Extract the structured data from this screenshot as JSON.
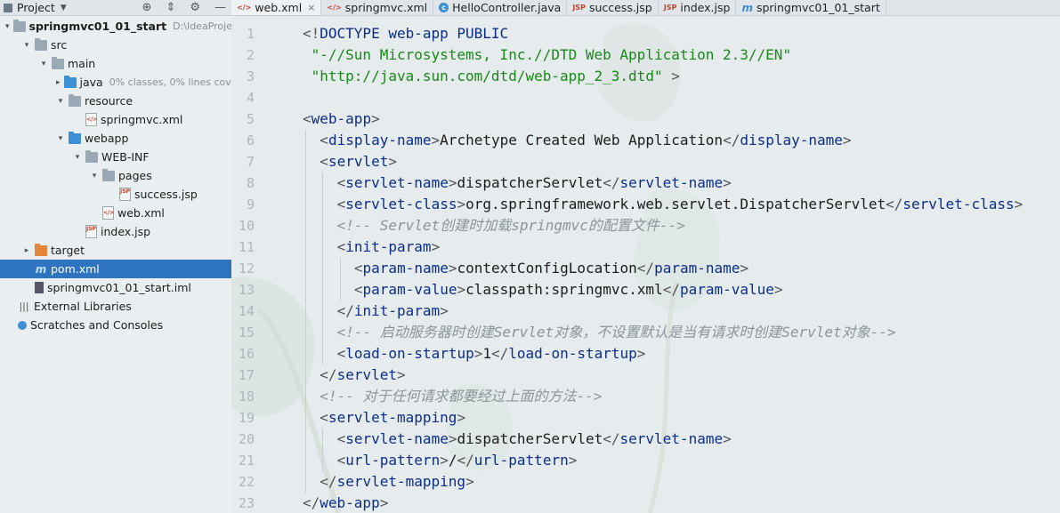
{
  "project_panel": {
    "title": "Project",
    "tree": [
      {
        "label": "springmvc01_01_start",
        "extra": "D:\\IdeaProjects\\",
        "indent": 0,
        "arrow": "open",
        "icon": "folder",
        "bold": true
      },
      {
        "label": "src",
        "indent": 1,
        "arrow": "open",
        "icon": "folder"
      },
      {
        "label": "main",
        "indent": 2,
        "arrow": "open",
        "icon": "folder"
      },
      {
        "label": "java",
        "extra": "0% classes, 0% lines cove",
        "indent": 3,
        "arrow": "closed",
        "icon": "folder-blue"
      },
      {
        "label": "resource",
        "indent": 3,
        "arrow": "open",
        "icon": "folder"
      },
      {
        "label": "springmvc.xml",
        "indent": 4,
        "arrow": "none",
        "icon": "xml"
      },
      {
        "label": "webapp",
        "indent": 3,
        "arrow": "open",
        "icon": "folder-blue"
      },
      {
        "label": "WEB-INF",
        "indent": 4,
        "arrow": "open",
        "icon": "folder"
      },
      {
        "label": "pages",
        "indent": 5,
        "arrow": "open",
        "icon": "folder"
      },
      {
        "label": "success.jsp",
        "indent": 6,
        "arrow": "none",
        "icon": "jsp"
      },
      {
        "label": "web.xml",
        "indent": 5,
        "arrow": "none",
        "icon": "xml"
      },
      {
        "label": "index.jsp",
        "indent": 4,
        "arrow": "none",
        "icon": "jsp"
      },
      {
        "label": "target",
        "indent": 1,
        "arrow": "closed",
        "icon": "folder-orange"
      },
      {
        "label": "pom.xml",
        "indent": 1,
        "arrow": "none",
        "icon": "maven",
        "selected": true
      },
      {
        "label": "springmvc01_01_start.iml",
        "indent": 1,
        "arrow": "none",
        "icon": "iml"
      },
      {
        "label": "External Libraries",
        "indent": 0,
        "arrow": "none",
        "icon": "library"
      },
      {
        "label": "Scratches and Consoles",
        "indent": 0,
        "arrow": "none",
        "icon": "scratches"
      }
    ]
  },
  "tabs": [
    {
      "label": "web.xml",
      "icon": "xml",
      "active": true,
      "close": true
    },
    {
      "label": "springmvc.xml",
      "icon": "xml"
    },
    {
      "label": "HelloController.java",
      "icon": "class"
    },
    {
      "label": "success.jsp",
      "icon": "jsp"
    },
    {
      "label": "index.jsp",
      "icon": "jsp"
    },
    {
      "label": "springmvc01_01_start",
      "icon": "maven"
    }
  ],
  "code_lines": [
    {
      "n": "1",
      "indent": 0,
      "parts": [
        [
          "br",
          "<!"
        ],
        [
          "tag",
          "DOCTYPE web-app PUBLIC"
        ]
      ]
    },
    {
      "n": "2",
      "indent": 0,
      "parts": [
        [
          "str",
          " \"-//Sun Microsystems, Inc.//DTD Web Application 2.3//EN\""
        ]
      ]
    },
    {
      "n": "3",
      "indent": 0,
      "parts": [
        [
          "str",
          " \"http://java.sun.com/dtd/web-app_2_3.dtd\""
        ],
        [
          "br",
          " >"
        ]
      ]
    },
    {
      "n": "4",
      "indent": 0,
      "parts": []
    },
    {
      "n": "5",
      "indent": 0,
      "parts": [
        [
          "br",
          "<"
        ],
        [
          "tag",
          "web-app"
        ],
        [
          "br",
          ">"
        ]
      ]
    },
    {
      "n": "6",
      "indent": 1,
      "parts": [
        [
          "br",
          "<"
        ],
        [
          "tag",
          "display-name"
        ],
        [
          "br",
          ">"
        ],
        [
          "txt",
          "Archetype Created Web Application"
        ],
        [
          "br",
          "</"
        ],
        [
          "tag",
          "display-name"
        ],
        [
          "br",
          ">"
        ]
      ]
    },
    {
      "n": "7",
      "indent": 1,
      "parts": [
        [
          "br",
          "<"
        ],
        [
          "tag",
          "servlet"
        ],
        [
          "br",
          ">"
        ]
      ]
    },
    {
      "n": "8",
      "indent": 2,
      "parts": [
        [
          "br",
          "<"
        ],
        [
          "tag",
          "servlet-name"
        ],
        [
          "br",
          ">"
        ],
        [
          "txt",
          "dispatcherServlet"
        ],
        [
          "br",
          "</"
        ],
        [
          "tag",
          "servlet-name"
        ],
        [
          "br",
          ">"
        ]
      ]
    },
    {
      "n": "9",
      "indent": 2,
      "parts": [
        [
          "br",
          "<"
        ],
        [
          "tag",
          "servlet-class"
        ],
        [
          "br",
          ">"
        ],
        [
          "txt",
          "org.springframework.web.servlet.DispatcherServlet"
        ],
        [
          "br",
          "</"
        ],
        [
          "tag",
          "servlet-class"
        ],
        [
          "br",
          ">"
        ]
      ]
    },
    {
      "n": "10",
      "indent": 2,
      "parts": [
        [
          "cmt",
          "<!-- Servlet创建时加载springmvc的配置文件-->"
        ]
      ]
    },
    {
      "n": "11",
      "indent": 2,
      "parts": [
        [
          "br",
          "<"
        ],
        [
          "tag",
          "init-param"
        ],
        [
          "br",
          ">"
        ]
      ]
    },
    {
      "n": "12",
      "indent": 3,
      "parts": [
        [
          "br",
          "<"
        ],
        [
          "tag",
          "param-name"
        ],
        [
          "br",
          ">"
        ],
        [
          "txt",
          "contextConfigLocation"
        ],
        [
          "br",
          "</"
        ],
        [
          "tag",
          "param-name"
        ],
        [
          "br",
          ">"
        ]
      ]
    },
    {
      "n": "13",
      "indent": 3,
      "parts": [
        [
          "br",
          "<"
        ],
        [
          "tag",
          "param-value"
        ],
        [
          "br",
          ">"
        ],
        [
          "txt",
          "classpath:springmvc.xml"
        ],
        [
          "br",
          "</"
        ],
        [
          "tag",
          "param-value"
        ],
        [
          "br",
          ">"
        ]
      ]
    },
    {
      "n": "14",
      "indent": 2,
      "parts": [
        [
          "br",
          "</"
        ],
        [
          "tag",
          "init-param"
        ],
        [
          "br",
          ">"
        ]
      ]
    },
    {
      "n": "15",
      "indent": 2,
      "parts": [
        [
          "cmt",
          "<!-- 启动服务器时创建Servlet对象，不设置默认是当有请求时创建Servlet对象-->"
        ]
      ]
    },
    {
      "n": "16",
      "indent": 2,
      "parts": [
        [
          "br",
          "<"
        ],
        [
          "tag",
          "load-on-startup"
        ],
        [
          "br",
          ">"
        ],
        [
          "txt",
          "1"
        ],
        [
          "br",
          "</"
        ],
        [
          "tag",
          "load-on-startup"
        ],
        [
          "br",
          ">"
        ]
      ]
    },
    {
      "n": "17",
      "indent": 1,
      "parts": [
        [
          "br",
          "</"
        ],
        [
          "tag",
          "servlet"
        ],
        [
          "br",
          ">"
        ]
      ]
    },
    {
      "n": "18",
      "indent": 1,
      "parts": [
        [
          "cmt",
          "<!-- 对于任何请求都要经过上面的方法-->"
        ]
      ]
    },
    {
      "n": "19",
      "indent": 1,
      "parts": [
        [
          "br",
          "<"
        ],
        [
          "tag",
          "servlet-mapping"
        ],
        [
          "br",
          ">"
        ]
      ]
    },
    {
      "n": "20",
      "indent": 2,
      "parts": [
        [
          "br",
          "<"
        ],
        [
          "tag",
          "servlet-name"
        ],
        [
          "br",
          ">"
        ],
        [
          "txt",
          "dispatcherServlet"
        ],
        [
          "br",
          "</"
        ],
        [
          "tag",
          "servlet-name"
        ],
        [
          "br",
          ">"
        ]
      ]
    },
    {
      "n": "21",
      "indent": 2,
      "parts": [
        [
          "br",
          "<"
        ],
        [
          "tag",
          "url-pattern"
        ],
        [
          "br",
          ">"
        ],
        [
          "txt",
          "/"
        ],
        [
          "br",
          "</"
        ],
        [
          "tag",
          "url-pattern"
        ],
        [
          "br",
          ">"
        ]
      ]
    },
    {
      "n": "22",
      "indent": 1,
      "parts": [
        [
          "br",
          "</"
        ],
        [
          "tag",
          "servlet-mapping"
        ],
        [
          "br",
          ">"
        ]
      ]
    },
    {
      "n": "23",
      "indent": 0,
      "parts": [
        [
          "br",
          "</"
        ],
        [
          "tag",
          "web-app"
        ],
        [
          "br",
          ">"
        ]
      ]
    }
  ]
}
